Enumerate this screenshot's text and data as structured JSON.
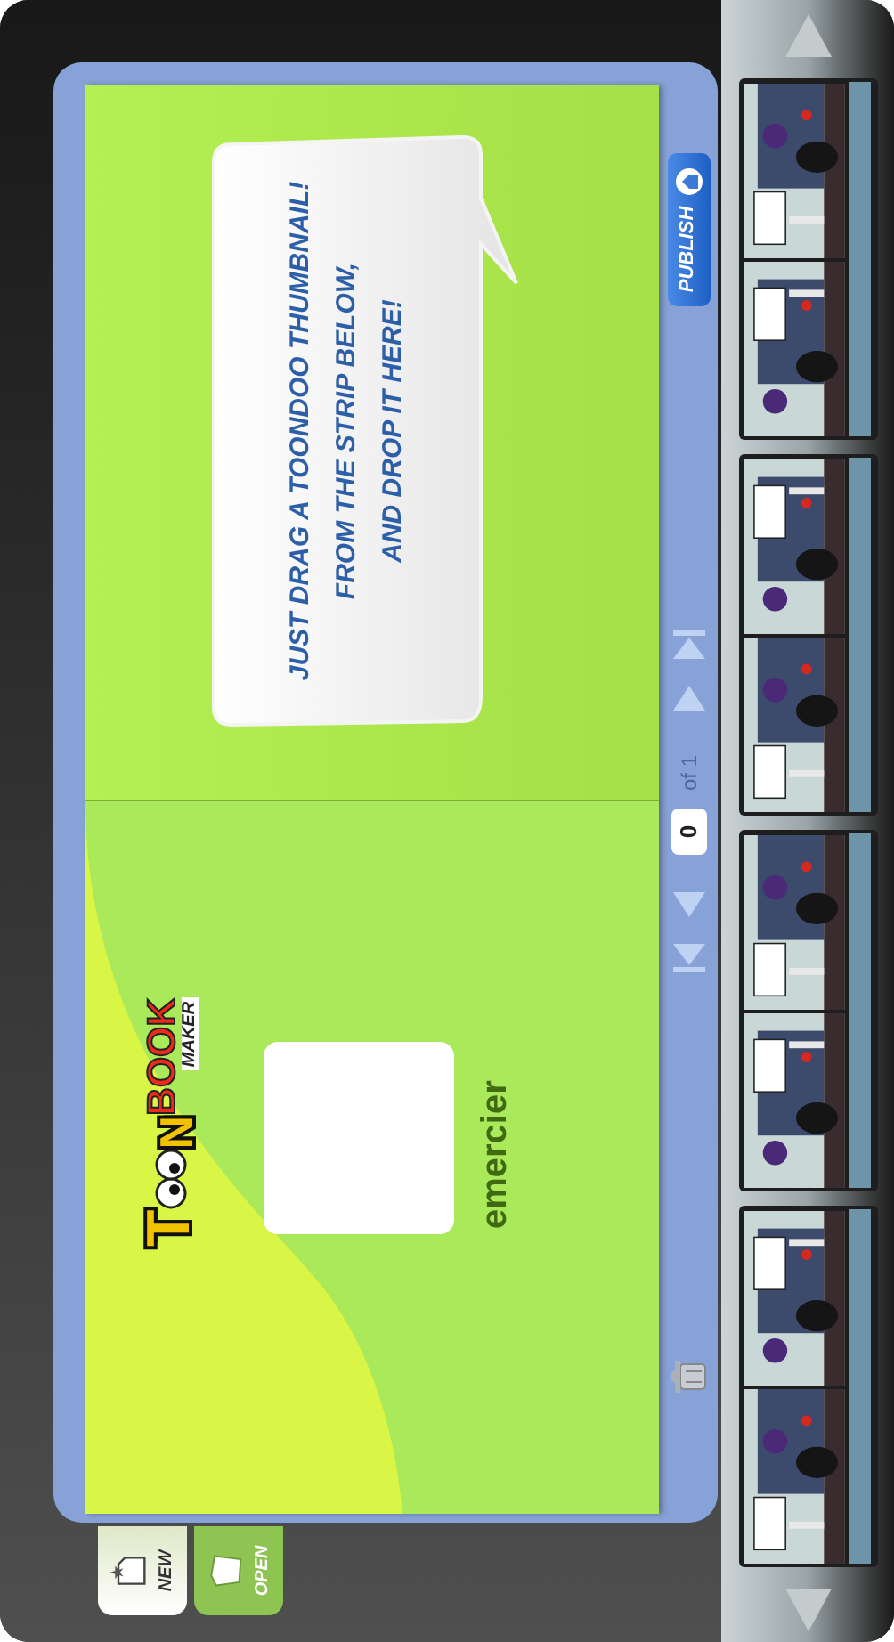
{
  "tabs": [
    {
      "label": "NEW",
      "selected": true
    },
    {
      "label": "OPEN",
      "selected": false
    }
  ],
  "left_page": {
    "logo": {
      "part_1": "T",
      "part_2": "N",
      "part_3": "BOOK",
      "tagline": "MAKER"
    },
    "author": "emercier"
  },
  "right_page": {
    "bubble_lines": [
      "JUST DRAG A TOONDOO THUMBNAIL!",
      "FROM THE STRIP BELOW,",
      "AND DROP IT HERE!"
    ]
  },
  "pager": {
    "page_value": "0",
    "total": "of 1"
  },
  "publish_button": "PUBLISH"
}
